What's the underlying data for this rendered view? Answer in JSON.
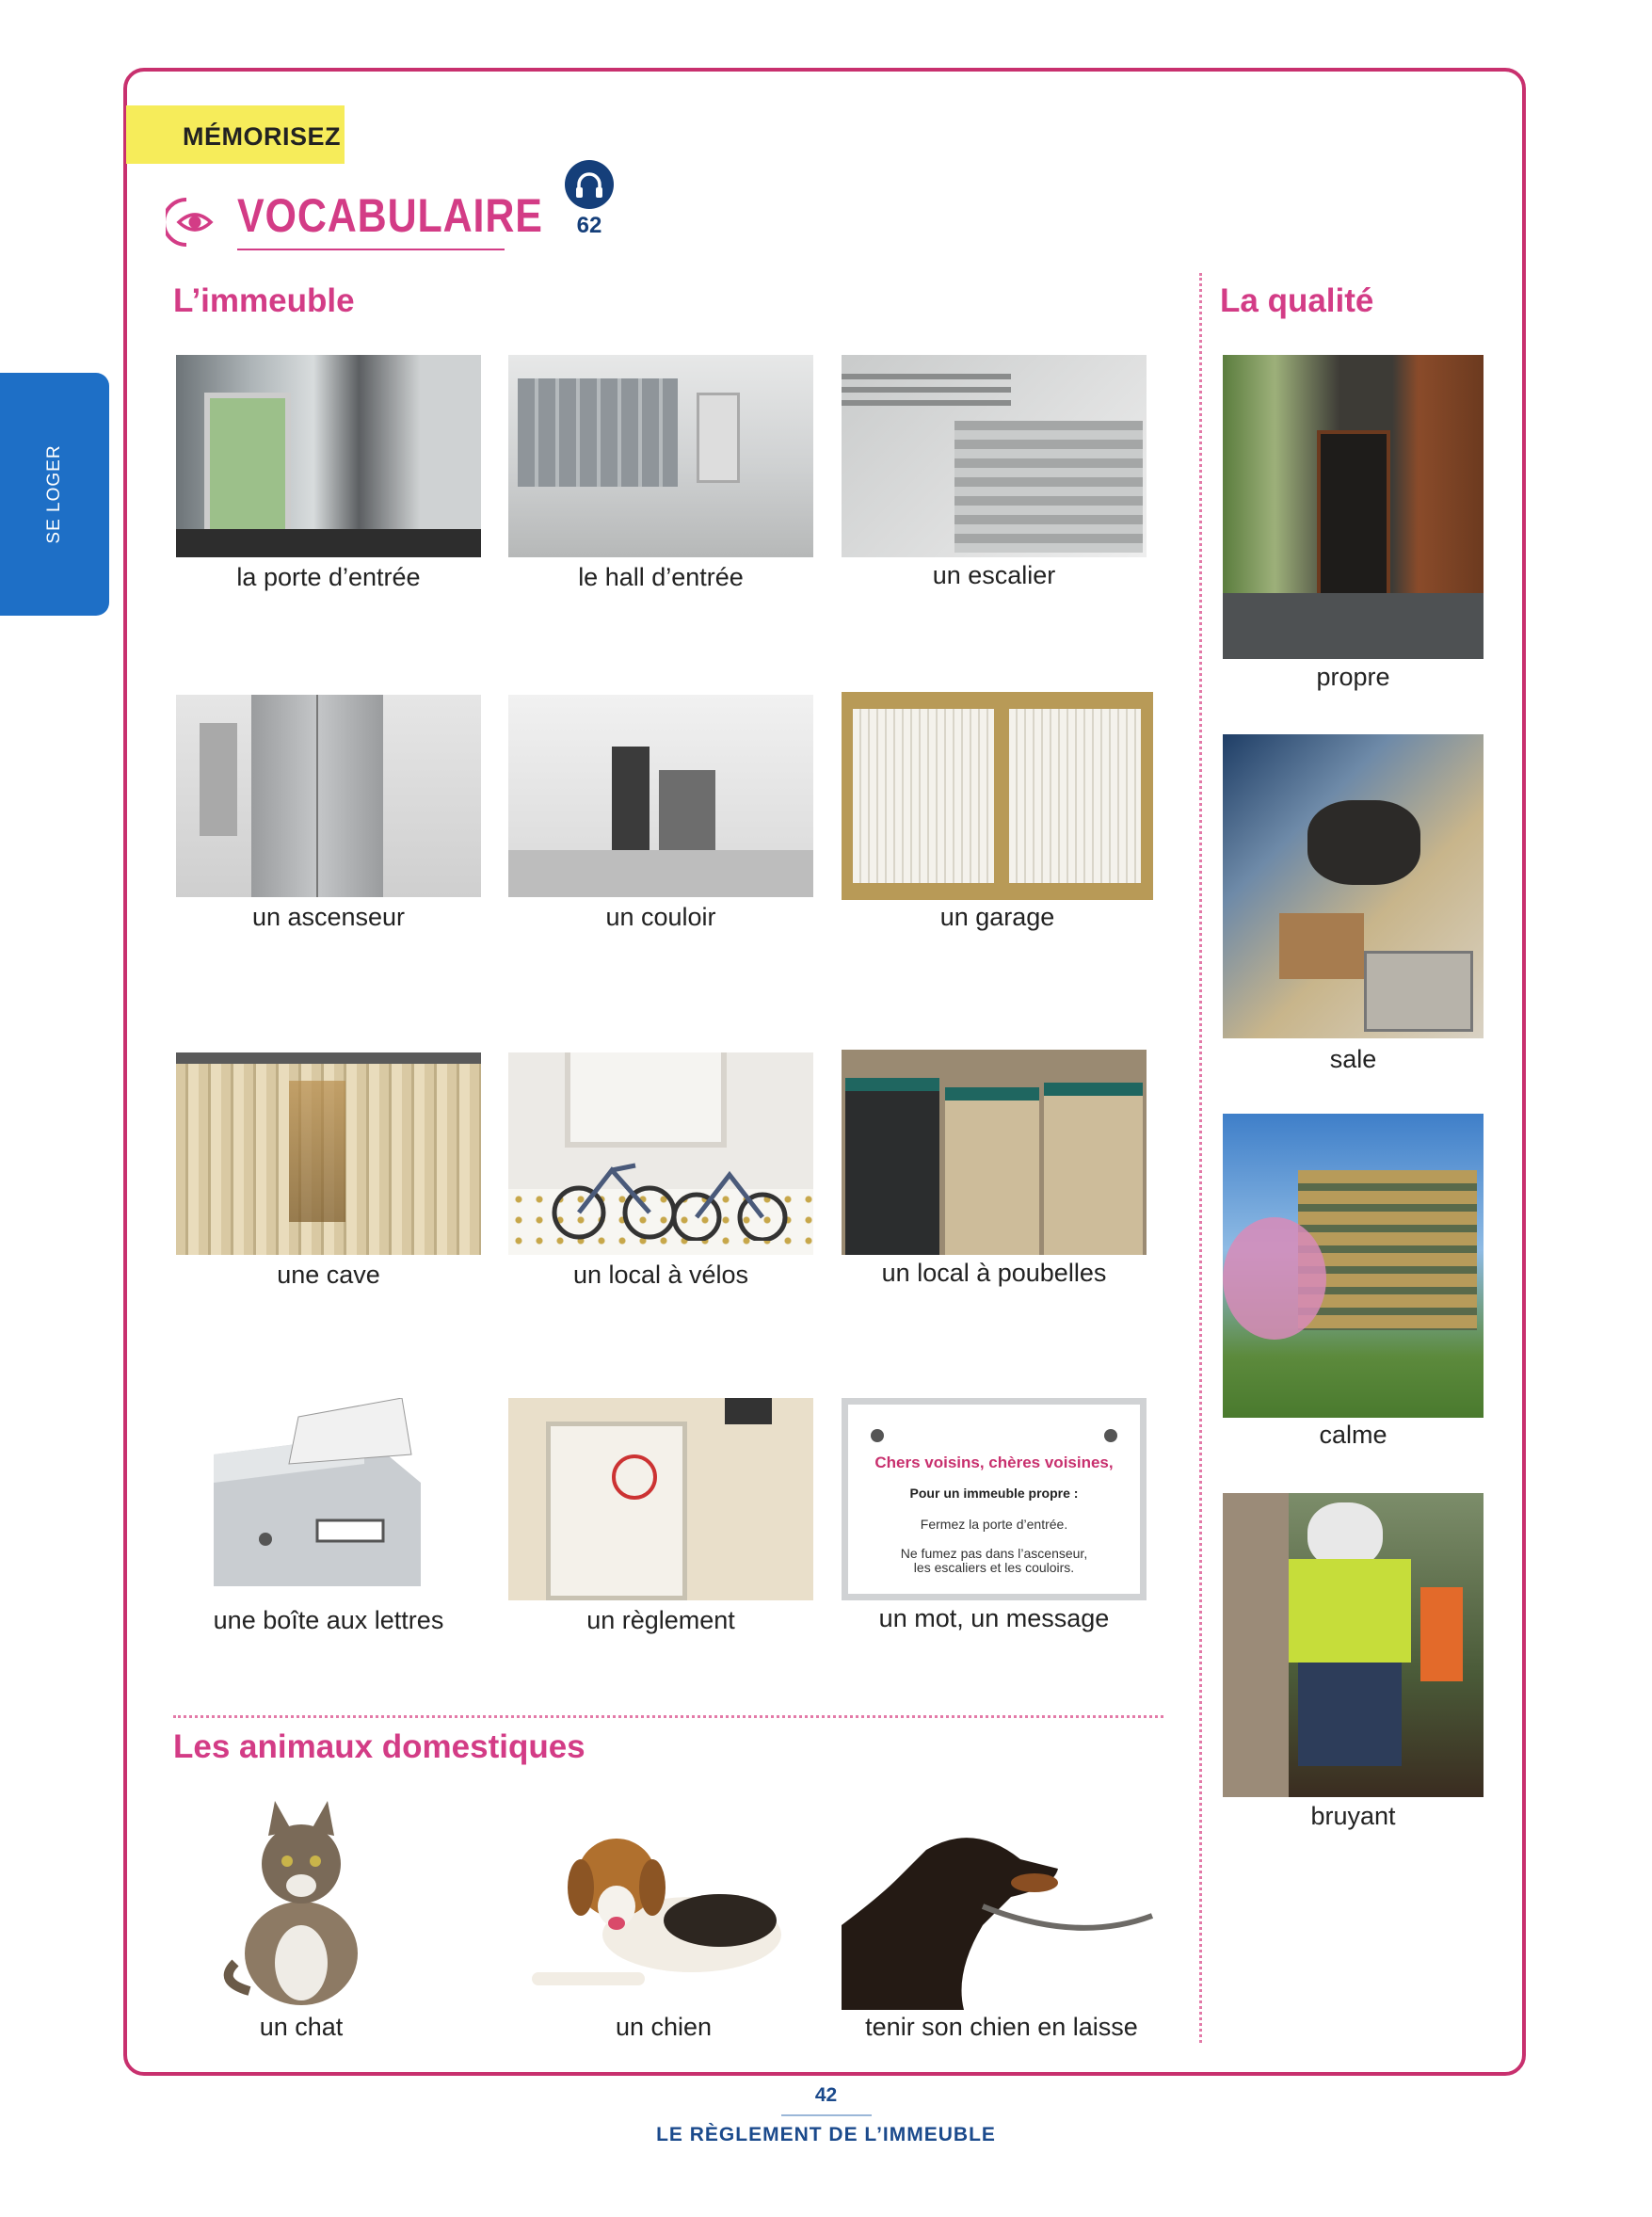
{
  "side_tab": "SE LOGER",
  "header": {
    "tag": "MÉMORISEZ",
    "title": "VOCABULAIRE",
    "track": "62",
    "eye_icon": "eye-icon",
    "audio_icon": "headphones-icon"
  },
  "sections": {
    "building": "L’immeuble",
    "quality": "La qualité",
    "pets": "Les animaux domestiques"
  },
  "building_items": [
    "la porte d’entrée",
    "le hall d’entrée",
    "un escalier",
    "un ascenseur",
    "un couloir",
    "un garage",
    "une cave",
    "un local à vélos",
    "un local à poubelles",
    "une boîte aux lettres",
    "un règlement",
    "un mot, un message"
  ],
  "quality_items": [
    "propre",
    "sale",
    "calme",
    "bruyant"
  ],
  "pet_items": [
    "un chat",
    "un chien",
    "tenir son chien en laisse"
  ],
  "notice": {
    "greeting": "Chers voisins, chères voisines,",
    "intro": "Pour un immeuble propre :",
    "line1": "Fermez la porte d’entrée.",
    "line2": "Ne fumez pas dans l’ascenseur,",
    "line3": "les escaliers et les couloirs."
  },
  "footer": {
    "page": "42",
    "chapter": "LE RÈGLEMENT DE L’IMMEUBLE"
  },
  "colors": {
    "accent": "#d33c86",
    "frame": "#c8306e",
    "blue": "#1e6fc6",
    "navy": "#1b4a8c",
    "yellow": "#f6ec5a"
  }
}
